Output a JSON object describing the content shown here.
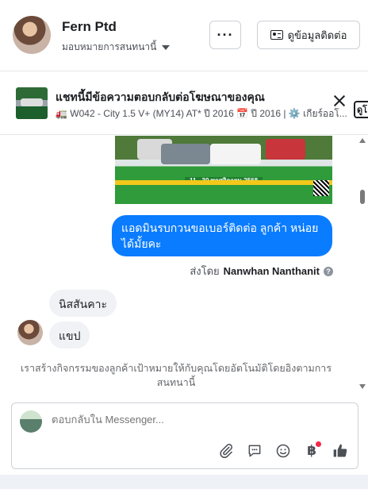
{
  "header": {
    "contact_name": "Fern Ptd",
    "assign_label": "มอบหมายการสนทนานี้",
    "more_label": "···",
    "contact_info_label": "ดูข้อมูลติดต่อ"
  },
  "banner": {
    "title": "แชทนี้มีข้อความตอบกลับต่อโฆษณาของคุณ",
    "subtitle": "🚛 W042 - City 1.5 V+ (MY14) AT* ปี 2016 📅 ปี 2016 | ⚙️ เกียร์ออโ...",
    "cut_button_label": "ดูโ"
  },
  "conversation": {
    "ad_date_text": "11 - 30 พฤศจิกายน 2568",
    "outgoing_message": "แอดมินรบกวนขอเบอร์ติดต่อ ลูกค้า หน่อยได้มั้ยคะ",
    "sent_by_prefix": "ส่งโดย",
    "sent_by_name": "Nanwhan Nanthanit",
    "incoming_messages": [
      "นิสสันคาะ",
      "แขป"
    ],
    "automation_note": "เราสร้างกิจกรรมของลูกค้าเป้าหมายให้กับคุณโดยอัตโนมัติโดยอิงตามการสนทนานี้"
  },
  "composer": {
    "placeholder": "ตอบกลับใน Messenger...",
    "tools": [
      "paperclip-icon",
      "speech-bubble-icon",
      "smiley-icon",
      "baht-icon",
      "thumbs-up-icon"
    ],
    "baht_symbol": "฿"
  },
  "colors": {
    "outgoing_bubble": "#0a7cff",
    "incoming_bubble": "#f0f2f5",
    "thumbs_up": "#0a7cff",
    "notification_dot": "#f02849"
  }
}
